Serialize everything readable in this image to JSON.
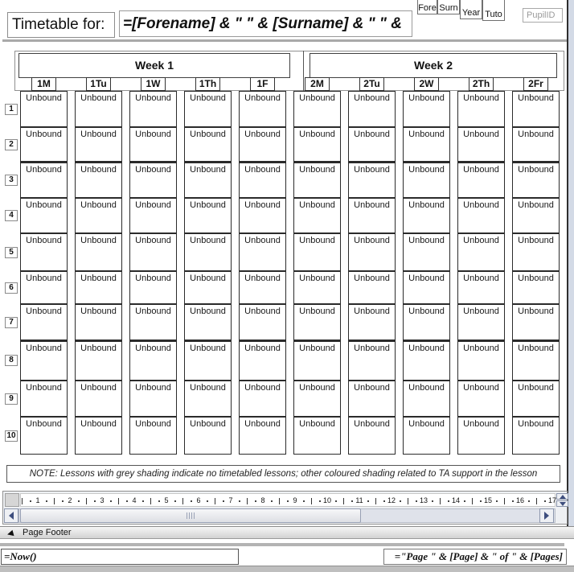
{
  "header": {
    "title_label": "Timetable for:",
    "title_formula": "=[Forename] & \" \" & [Surname] & \"  \" &",
    "mini_fields": [
      "Fore",
      "Surn",
      "Year",
      "Tuto"
    ],
    "pupil_id_label": "PupilID"
  },
  "weeks": [
    {
      "label": "Week 1",
      "days": [
        "1M",
        "1Tu",
        "1W",
        "1Th",
        "1F"
      ]
    },
    {
      "label": "Week 2",
      "days": [
        "2M",
        "2Tu",
        "2W",
        "2Th",
        "2Fr"
      ]
    }
  ],
  "grid": {
    "rows": [
      "1",
      "2",
      "3",
      "4",
      "5",
      "6",
      "7",
      "8",
      "9",
      "10"
    ],
    "cell_text": "Unbound"
  },
  "note": {
    "text": "NOTE: Lessons with grey shading indicate no timetabled lessons; other coloured shading related to TA support in the lesson"
  },
  "ruler": {
    "numbers": [
      "1",
      "2",
      "3",
      "4",
      "5",
      "6",
      "7",
      "8",
      "9",
      "10",
      "11",
      "12",
      "13",
      "14",
      "15",
      "16",
      "17"
    ]
  },
  "footer": {
    "section_label": "Page Footer",
    "date_formula": "=Now()",
    "page_formula": "=\"Page \" & [Page] & \" of \" & [Pages]"
  },
  "colors": {
    "page_edge": "#2e2e2e",
    "design_margin_bg": "#d3dae6",
    "grid_border": "#2b2b2b",
    "control_border_gray": "#8c8c8c",
    "muted_text": "#9a9a9a",
    "scroll_arrow": "#3e4e7e",
    "scrollbar_track": "#dfe2ea",
    "section_bar_from": "#f6f6f6",
    "section_bar_to": "#d2d2d2"
  }
}
